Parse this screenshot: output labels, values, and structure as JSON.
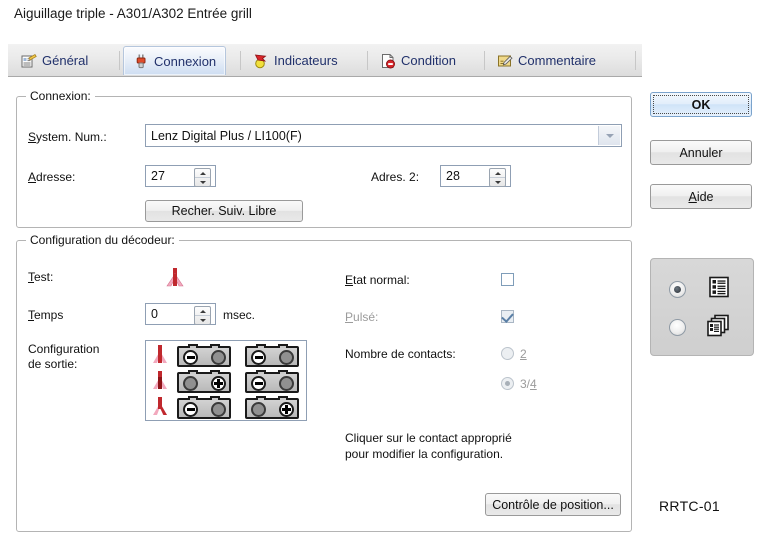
{
  "window": {
    "title": "Aiguillage triple - A301/A302 Entrée grill",
    "brand": "RRTC-01"
  },
  "tabs": [
    {
      "label": "Général",
      "icon": "general-properties-icon",
      "selected": false
    },
    {
      "label": "Connexion",
      "icon": "plug-connector-icon",
      "selected": true
    },
    {
      "label": "Indicateurs",
      "icon": "indicator-signal-icon",
      "selected": false
    },
    {
      "label": "Condition",
      "icon": "condition-rule-icon",
      "selected": false
    },
    {
      "label": "Commentaire",
      "icon": "comment-edit-icon",
      "selected": false
    }
  ],
  "connexion": {
    "group_title": "Connexion:",
    "system_label": "System. Num.:",
    "system_value": "Lenz Digital Plus / LI100(F)",
    "adresse_label": "Adresse:",
    "adresse_value": "27",
    "adres2_label": "Adres. 2:",
    "adres2_value": "28",
    "search_button": "Recher. Suiv. Libre"
  },
  "decodeur": {
    "group_title": "Configuration du décodeur:",
    "test_label": "Test:",
    "test_icon": "triple-turnout-icon",
    "temps_label": "Temps",
    "temps_value": "0",
    "temps_unit": "msec.",
    "config_label_line1": "Configuration",
    "config_label_line2": "de sortie:",
    "etat_normal_label": "Etat normal:",
    "etat_normal_checked": false,
    "pulse_label": "Pulsé:",
    "pulse_checked": true,
    "pulse_disabled": true,
    "contacts_label": "Nombre de contacts:",
    "contacts_options": [
      {
        "label": "2",
        "selected": false,
        "disabled": true
      },
      {
        "label": "3/4",
        "selected": true,
        "disabled": true
      }
    ],
    "hint_line1": "Cliquer sur le contact approprié",
    "hint_line2": "pour modifier la configuration.",
    "position_button": "Contrôle de position...",
    "output_rows": [
      {
        "turnout_icon": "turnout-left-icon",
        "cells": [
          {
            "c1": "minus",
            "c2": "off"
          },
          {
            "c1": "minus",
            "c2": "off"
          }
        ]
      },
      {
        "turnout_icon": "turnout-straight-icon",
        "cells": [
          {
            "c1": "off",
            "c2": "plus"
          },
          {
            "c1": "minus",
            "c2": "off"
          }
        ]
      },
      {
        "turnout_icon": "turnout-right-icon",
        "cells": [
          {
            "c1": "minus",
            "c2": "off"
          },
          {
            "c1": "off",
            "c2": "plus"
          }
        ]
      }
    ]
  },
  "buttons": {
    "ok": "OK",
    "cancel": "Annuler",
    "help": "Aide"
  },
  "viewmode": {
    "options": [
      {
        "icon": "list-view-icon",
        "selected": true
      },
      {
        "icon": "cascade-view-icon",
        "selected": false
      }
    ]
  },
  "colors": {
    "accent": "#21316b",
    "turnout_red": "#c0282d",
    "turnout_pink": "#f0a0b4",
    "dialog_bg": "#ffffff"
  }
}
